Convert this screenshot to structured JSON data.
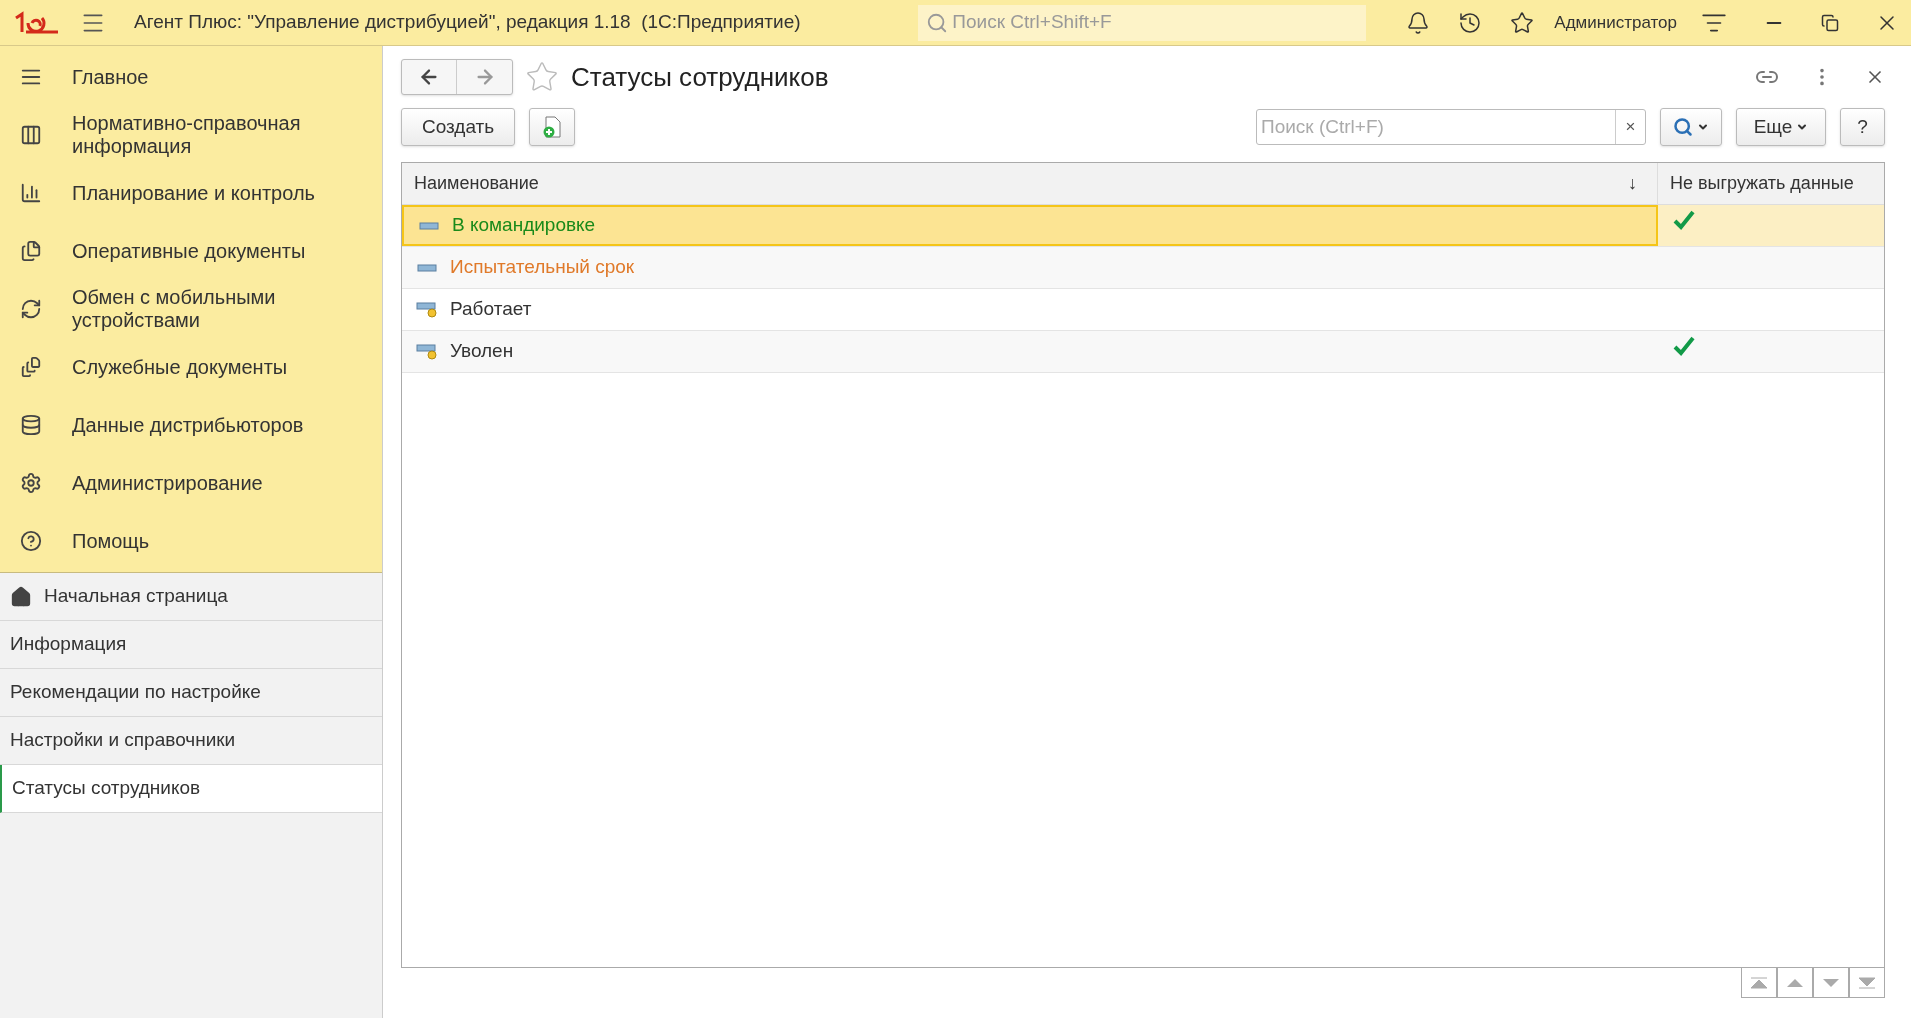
{
  "title_bar": {
    "title": "Агент Плюс: \"Управление дистрибуцией\", редакция 1.18  (1С:Предприятие)",
    "search_placeholder": "Поиск Ctrl+Shift+F",
    "user": "Администратор"
  },
  "sections": [
    {
      "label": "Главное"
    },
    {
      "label": "Нормативно-справочная информация"
    },
    {
      "label": "Планирование и контроль"
    },
    {
      "label": "Оперативные документы"
    },
    {
      "label": "Обмен с мобильными устройствами"
    },
    {
      "label": "Служебные документы"
    },
    {
      "label": "Данные дистрибьюторов"
    },
    {
      "label": "Администрирование"
    },
    {
      "label": "Помощь"
    }
  ],
  "open_pages": [
    {
      "label": "Начальная страница",
      "kind": "home",
      "selected": false
    },
    {
      "label": "Информация",
      "kind": "page",
      "selected": false
    },
    {
      "label": "Рекомендации по настройке",
      "kind": "page",
      "selected": false
    },
    {
      "label": "Настройки и справочники",
      "kind": "page",
      "selected": false
    },
    {
      "label": "Статусы сотрудников",
      "kind": "page",
      "selected": true
    }
  ],
  "form": {
    "title": "Статусы сотрудников",
    "favorite": false,
    "create_button": "Создать",
    "search_placeholder": "Поиск (Ctrl+F)",
    "clear": "×",
    "more_button": "Еще",
    "help_button": "?"
  },
  "table": {
    "columns": [
      {
        "label": "Наименование",
        "sort": "↓"
      },
      {
        "label": "Не выгружать данные"
      }
    ],
    "rows": [
      {
        "name": "В командировке",
        "kind": "plain",
        "color": "#1a8a1a",
        "checked": true,
        "selected": true
      },
      {
        "name": "Испытательный срок",
        "kind": "plain",
        "color": "#e07a2a",
        "checked": false,
        "selected": false
      },
      {
        "name": "Работает",
        "kind": "marked",
        "color": "#333333",
        "checked": false,
        "selected": false
      },
      {
        "name": "Уволен",
        "kind": "marked",
        "color": "#333333",
        "checked": true,
        "selected": false
      }
    ]
  }
}
